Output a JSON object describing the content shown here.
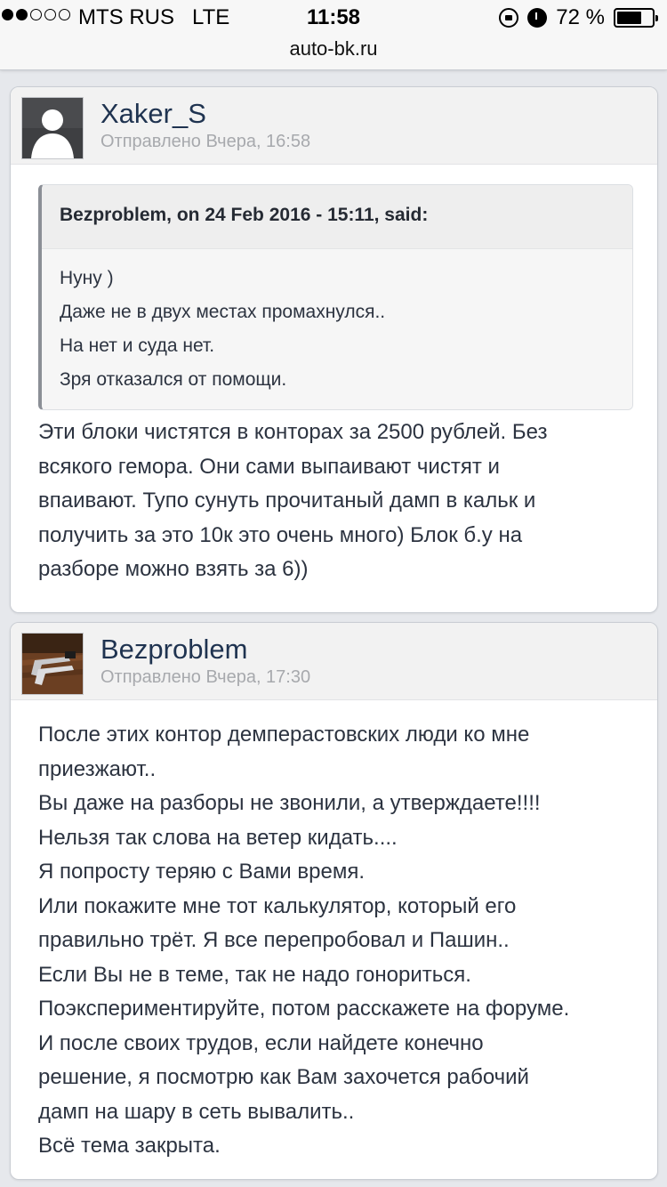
{
  "status_bar": {
    "carrier": "MTS RUS",
    "network": "LTE",
    "time": "11:58",
    "battery_text": "72 %",
    "battery_level": 0.72
  },
  "browser": {
    "url": "auto-bk.ru"
  },
  "posts": [
    {
      "author": "Xaker_S",
      "date": "Отправлено Вчера, 16:58",
      "quote": {
        "header": "Bezproblem, on 24 Feb 2016 - 15:11, said:",
        "lines": [
          "Нуну )",
          "Даже не в двух местах промахнулся..",
          "На нет и суда нет.",
          "Зря отказался от помощи."
        ]
      },
      "lines": [
        "Эти блоки чистятся в конторах за 2500 рублей. Без",
        "всякого гемора. Они сами выпаивают чистят и",
        "впаивают. Тупо сунуть прочитаный дамп в кальк и",
        "получить за это 10к это очень много) Блок б.у на",
        "разборе можно взять за 6))"
      ]
    },
    {
      "author": "Bezproblem",
      "date": "Отправлено Вчера, 17:30",
      "lines": [
        "После этих контор демперастовских люди ко мне",
        "приезжают..",
        "Вы даже на разборы не звонили, а утверждаете!!!!",
        "Нельзя так слова на ветер кидать....",
        "Я попросту теряю с Вами время.",
        "Или покажите мне тот калькулятор, который его",
        "правильно трёт. Я все перепробовал и Пашин..",
        "Если Вы не в теме, так не надо гонориться.",
        "Поэкспериментируйте, потом расскажете на форуме.",
        "И после своих трудов, если найдете конечно",
        "решение, я посмотрю как Вам захочется рабочий",
        "дамп на шару в сеть вывалить..",
        "Всё тема закрыта."
      ]
    }
  ]
}
